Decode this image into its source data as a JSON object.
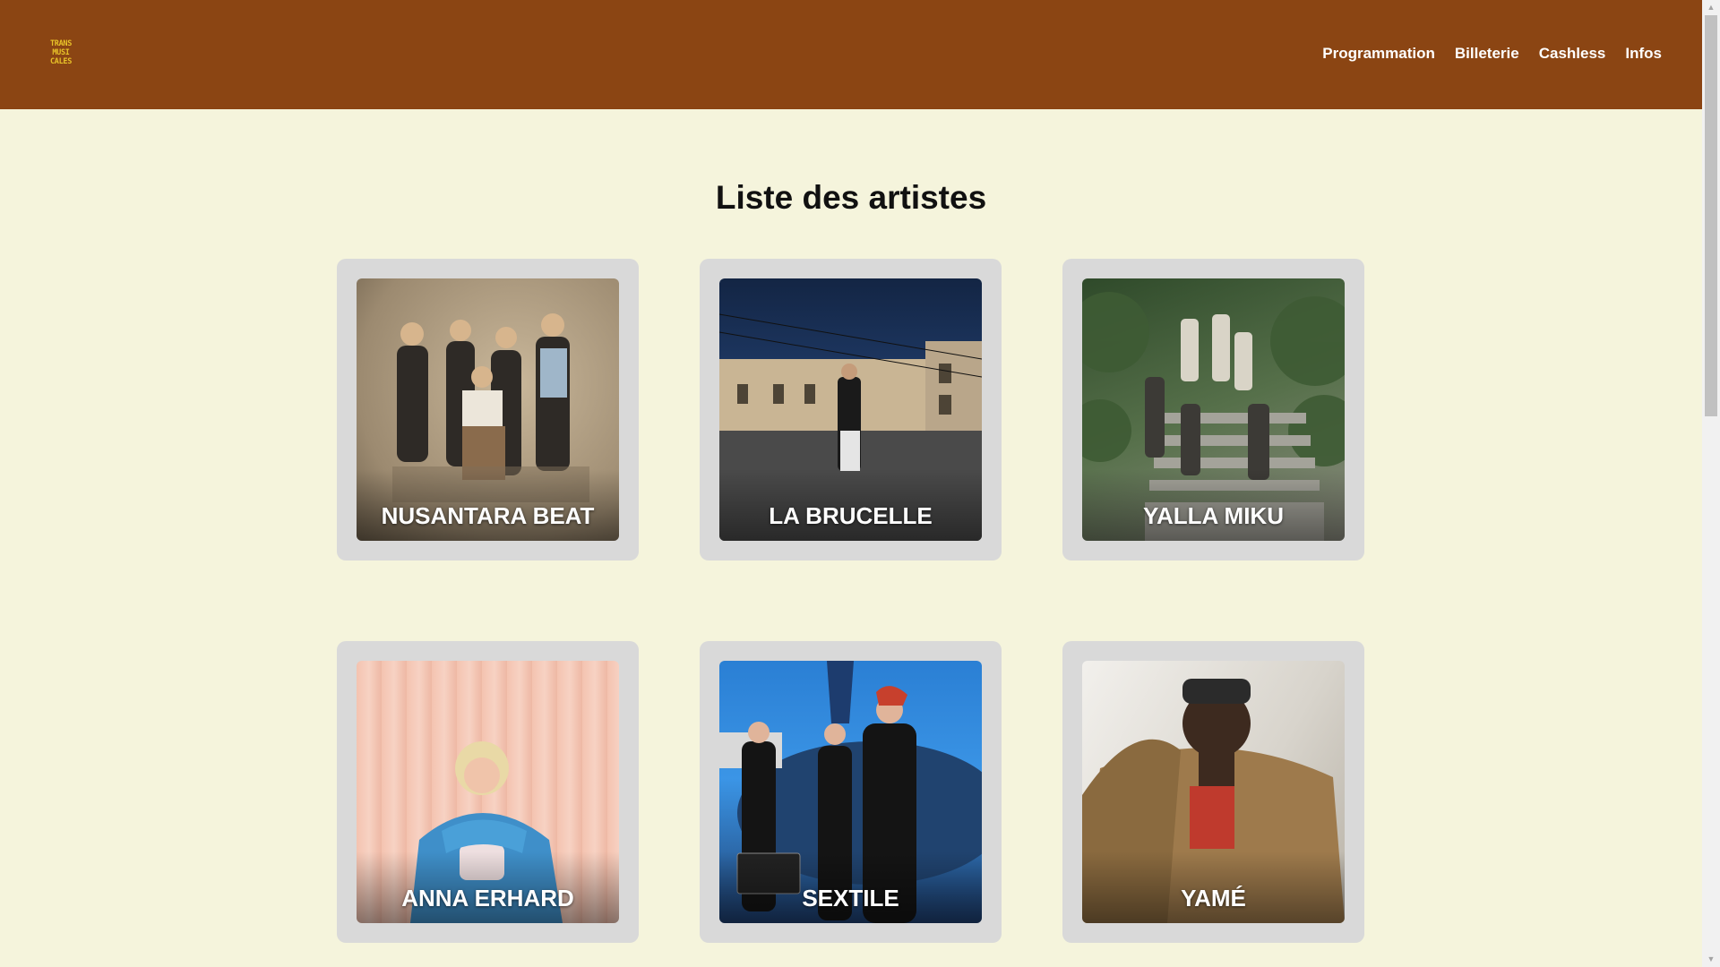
{
  "header": {
    "logo_lines": [
      "TRANS",
      "MUSI",
      "CALES"
    ],
    "nav": [
      "Programmation",
      "Billeterie",
      "Cashless",
      "Infos"
    ],
    "bg_color": "#8b4513"
  },
  "page": {
    "title": "Liste des artistes",
    "bg_color": "#f5f4dc"
  },
  "artists": [
    {
      "name": "NUSANTARA BEAT"
    },
    {
      "name": "LA BRUCELLE"
    },
    {
      "name": "YALLA MIKU"
    },
    {
      "name": "ANNA ERHARD"
    },
    {
      "name": "SEXTILE"
    },
    {
      "name": "YAMÉ"
    }
  ],
  "scrollbar": {
    "up_icon": "arrow-up-icon",
    "down_icon": "arrow-down-icon"
  }
}
